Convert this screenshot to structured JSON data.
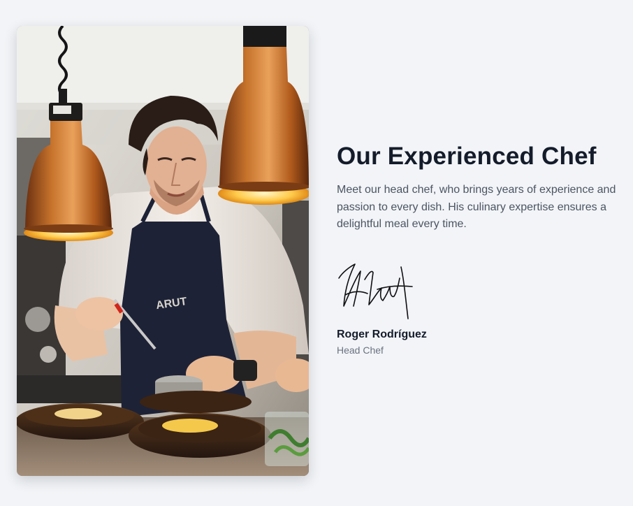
{
  "chef_section": {
    "title": "Our Experienced Chef",
    "description": "Meet our head chef, who brings years of experience and passion to every dish. His culinary expertise ensures a delightful meal every time.",
    "chef": {
      "name": "Roger Rodríguez",
      "role": "Head Chef"
    },
    "photo": {
      "icon": "chef-photo",
      "alt": "Chef plating food under copper heat lamps"
    },
    "signature_icon": "signature-icon"
  },
  "colors": {
    "page_background": "#f2f4f7",
    "heading": "#141c2b",
    "body_text": "#4b5563",
    "muted_text": "#6b7280",
    "copper": "#b8611f"
  }
}
